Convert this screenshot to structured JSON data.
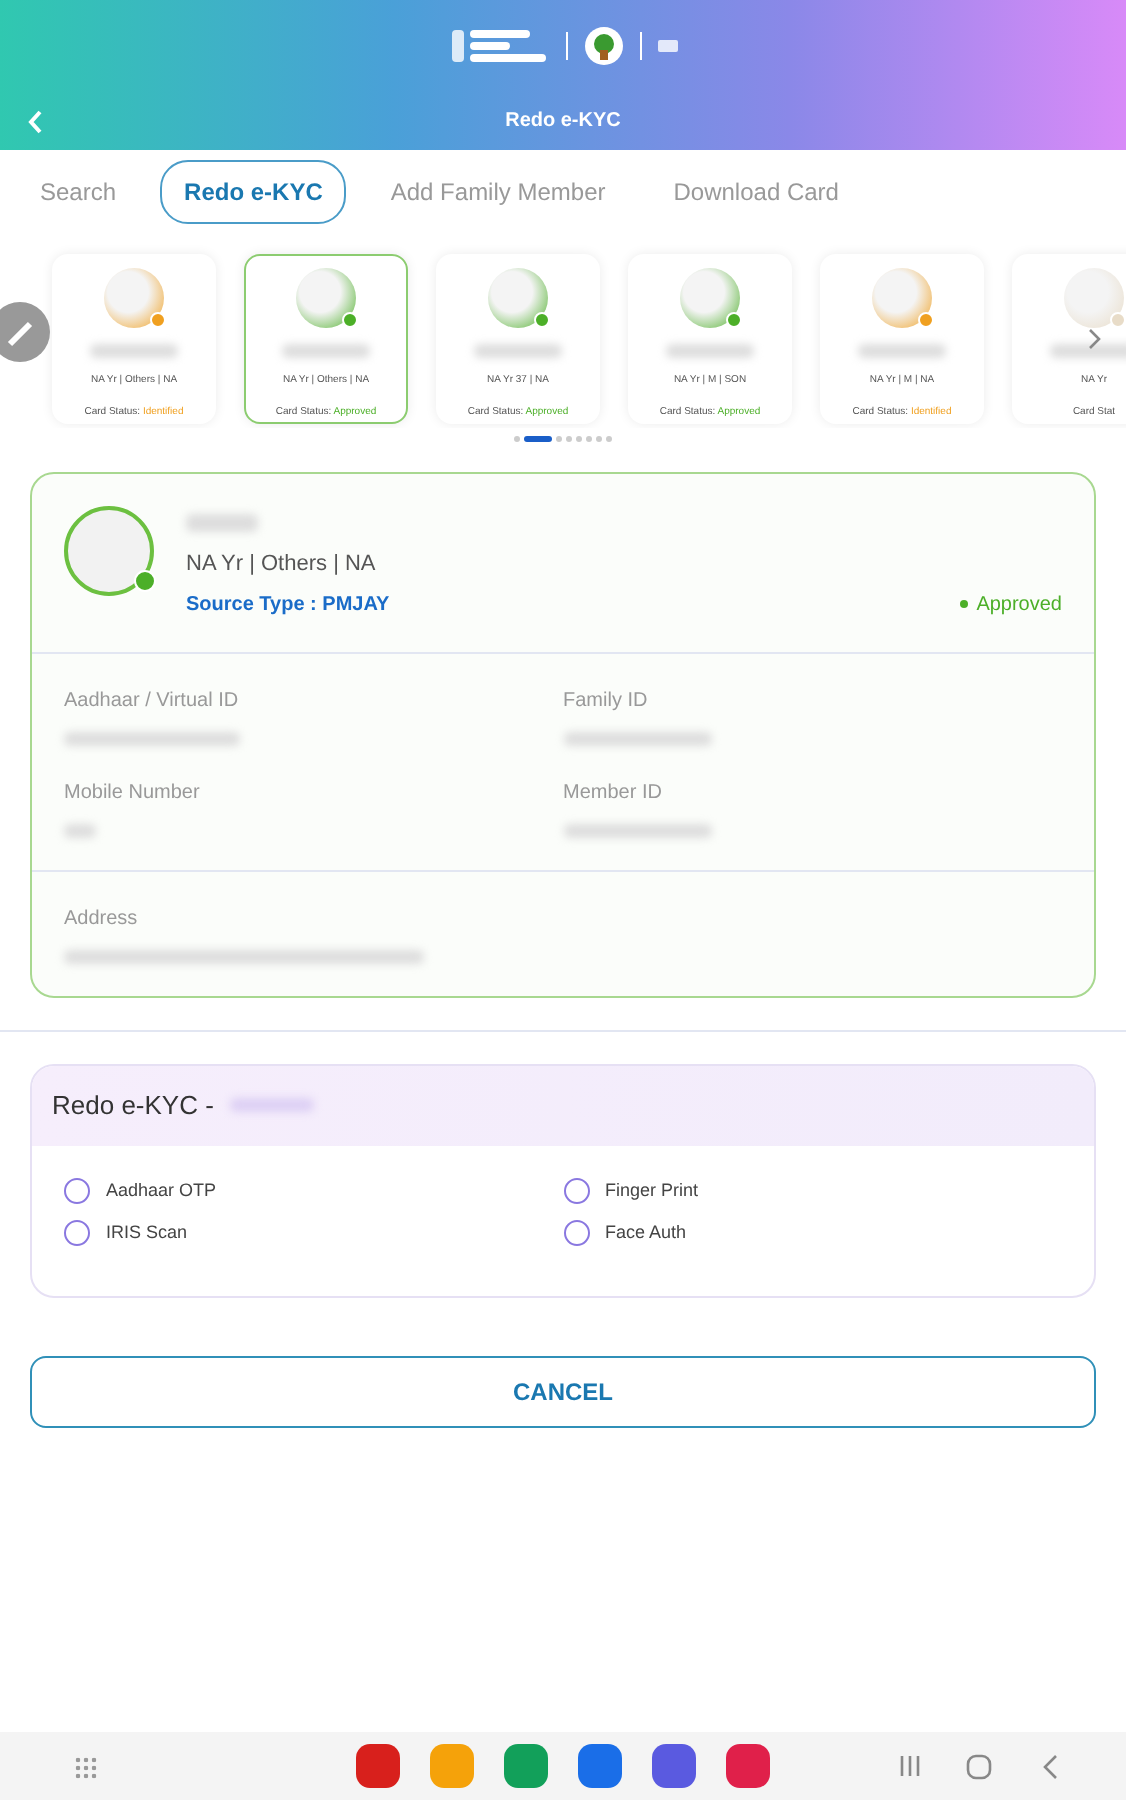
{
  "header": {
    "title": "Redo e-KYC"
  },
  "tabs": [
    {
      "label": "Search",
      "selected": false
    },
    {
      "label": "Redo e-KYC",
      "selected": true
    },
    {
      "label": "Add Family Member",
      "selected": false
    },
    {
      "label": "Download Card",
      "selected": false
    }
  ],
  "members": [
    {
      "info": "NA Yr | Others | NA",
      "status_label": "Card Status:",
      "status": "Identified",
      "color": "#f0a020",
      "selected": false
    },
    {
      "info": "NA Yr | Others | NA",
      "status_label": "Card Status:",
      "status": "Approved",
      "color": "#4caf28",
      "selected": true
    },
    {
      "info": "NA Yr 37 | NA",
      "status_label": "Card Status:",
      "status": "Approved",
      "color": "#4caf28",
      "selected": false
    },
    {
      "info": "NA Yr | M | SON",
      "status_label": "Card Status:",
      "status": "Approved",
      "color": "#4caf28",
      "selected": false
    },
    {
      "info": "NA Yr | M | NA",
      "status_label": "Card Status:",
      "status": "Identified",
      "color": "#f0a020",
      "selected": false
    },
    {
      "info": "NA Yr",
      "status_label": "Card Stat",
      "color": "#e8dcc8",
      "selected": false
    }
  ],
  "pager": [
    {
      "selected": false
    },
    {
      "selected": true
    },
    {
      "selected": false
    },
    {
      "selected": false
    },
    {
      "selected": false
    },
    {
      "selected": false
    },
    {
      "selected": false
    },
    {
      "selected": false
    }
  ],
  "profile": {
    "info": "NA Yr | Others | NA",
    "source": "Source Type : PMJAY",
    "status": "Approved",
    "fields": [
      {
        "label": "Aadhaar / Virtual ID"
      },
      {
        "label": "Family ID"
      },
      {
        "label": "Mobile Number"
      },
      {
        "label": "Member ID"
      }
    ],
    "address_label": "Address"
  },
  "kyc": {
    "title": "Redo e-KYC -",
    "options": [
      {
        "label": "Aadhaar OTP",
        "selected": false
      },
      {
        "label": "Finger Print",
        "selected": false
      },
      {
        "label": "IRIS Scan",
        "selected": false
      },
      {
        "label": "Face Auth",
        "selected": false
      }
    ]
  },
  "cancel": "CANCEL",
  "dock": [
    {
      "color": "#d8201c"
    },
    {
      "color": "#f5a20a"
    },
    {
      "color": "#12a05a"
    },
    {
      "color": "#1a6ee8"
    },
    {
      "color": "#5a5ae0"
    },
    {
      "color": "#e0204a"
    }
  ]
}
